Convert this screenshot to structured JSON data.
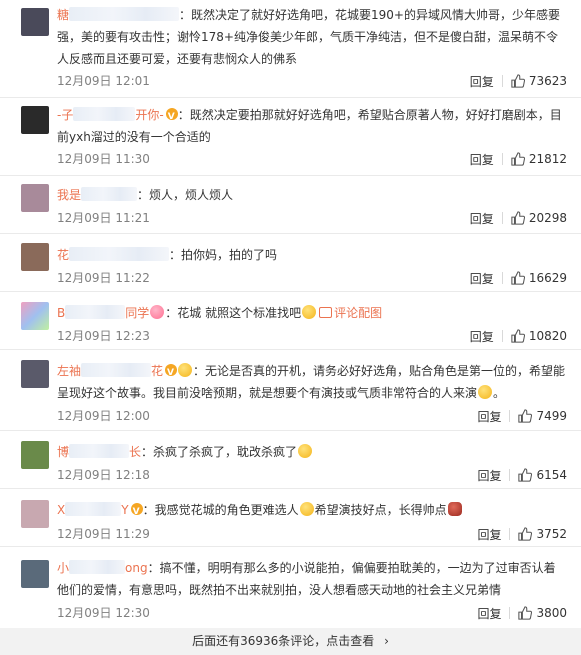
{
  "comments": [
    {
      "user_visible": "糖",
      "user_suffix": "",
      "verified": false,
      "text": "：既然决定了就好好选角吧，花城要190+的异域风情大帅哥，少年感要强，美的要有攻击性；谢怜178+纯净俊美少年郎，气质干净纯洁，但不是傻白甜，温呆萌不令人反感而且还要可爱，还要有悲悯众人的佛系",
      "time": "12月09日 12:01",
      "reply": "回复",
      "likes": "73623",
      "avatar_color": "#4a4a5a"
    },
    {
      "user_visible": "-子",
      "user_suffix": "开你-",
      "verified": true,
      "text": "：既然决定要拍那就好好选角吧，希望贴合原著人物，好好打磨剧本，目前yxh溜过的没有一个合适的",
      "time": "12月09日 11:30",
      "reply": "回复",
      "likes": "21812",
      "avatar_color": "#2a2a2a"
    },
    {
      "user_visible": "我是",
      "user_suffix": "",
      "verified": false,
      "text": "：烦人，烦人烦人",
      "time": "12月09日 11:21",
      "reply": "回复",
      "likes": "20298",
      "avatar_color": "#a88a9a"
    },
    {
      "user_visible": "花",
      "user_suffix": "",
      "verified": false,
      "text": "：拍你妈，拍的了吗",
      "time": "12月09日 11:22",
      "reply": "回复",
      "likes": "16629",
      "avatar_color": "#8a6a5a"
    },
    {
      "user_visible": "B",
      "user_suffix": "同学",
      "verified": false,
      "text_before": "：花城 就照这个标准找吧",
      "link_text": "评论配图",
      "time": "12月09日 12:23",
      "reply": "回复",
      "likes": "10820",
      "avatar_color": "#7a9ad0"
    },
    {
      "user_visible": "左袖",
      "user_suffix": "花",
      "verified": true,
      "text": "：无论是否真的开机，请务必好好选角，贴合角色是第一位的，希望能呈现好这个故事。我目前没啥预期，就是想要个有演技或气质非常符合的人来演",
      "text_end": "。",
      "time": "12月09日 12:00",
      "reply": "回复",
      "likes": "7499",
      "avatar_color": "#5a5a6a"
    },
    {
      "user_visible": "博",
      "user_suffix": "长",
      "verified": false,
      "text": "：杀疯了杀疯了，耽改杀疯了",
      "time": "12月09日 12:18",
      "reply": "回复",
      "likes": "6154",
      "avatar_color": "#6a8a4a"
    },
    {
      "user_visible": "X",
      "user_suffix": "Y",
      "verified": true,
      "text_before": "：我感觉花城的角色更难选人",
      "text_mid": "希望演技好点，长得帅点",
      "time": "12月09日 11:29",
      "reply": "回复",
      "likes": "3752",
      "avatar_color": "#c8a8b0"
    },
    {
      "user_visible": "小",
      "user_suffix": "ong",
      "verified": false,
      "text": "：搞不懂，明明有那么多的小说能拍，偏偏要拍耽美的，一边为了过审否认着他们的爱情，有意思吗，既然拍不出来就别拍，没人想看感天动地的社会主义兄弟情",
      "time": "12月09日 12:30",
      "reply": "回复",
      "likes": "3800",
      "avatar_color": "#5a6a7a"
    }
  ],
  "footer": {
    "more_text": "后面还有36936条评论，点击查看",
    "chevron": "›"
  }
}
